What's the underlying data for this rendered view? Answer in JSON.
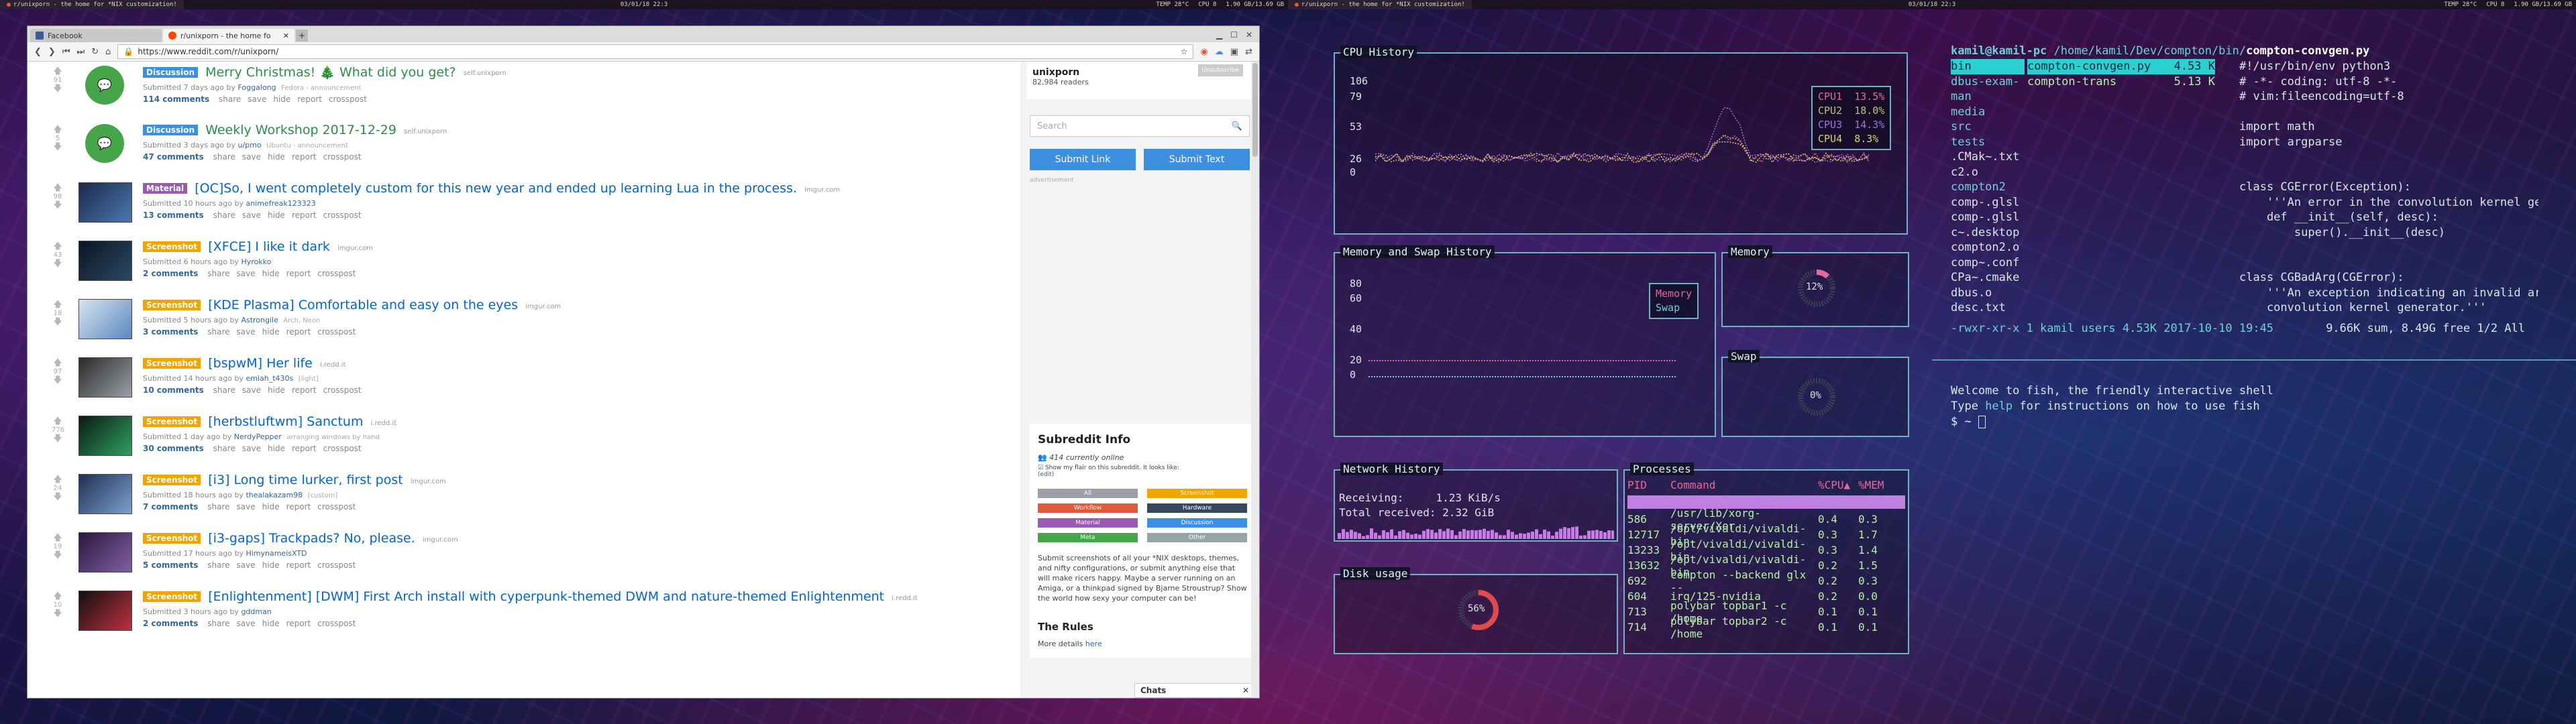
{
  "left_topbar": {
    "tabs": [
      "r/unixporn - the home for *NIX customization!"
    ],
    "clock": "03/01/18 22:3",
    "right": [
      "TEMP 28°C",
      "CPU 8",
      "1.90 GB/13.69 GB"
    ]
  },
  "right_topbar": {
    "tabs": [
      "r/unixporn - the home for *NIX customization!"
    ],
    "clock": "03/01/18 22:3",
    "right": [
      "TEMP 28°C",
      "CPU 8",
      "1.90 GB/13.69 GB"
    ]
  },
  "browser": {
    "tabs": [
      {
        "label": "Facebook",
        "color": "#3b5998"
      },
      {
        "label": "r/unixporn - the home fo",
        "color": "#ff4500"
      }
    ],
    "url": "https://www.reddit.com/r/unixporn/"
  },
  "posts": [
    {
      "score": "91",
      "flair": "Discussion",
      "flair_color": "#3d8fe0",
      "title": "Merry Christmas! 🎄 What did you get?",
      "domain": "self.unixporn",
      "meta_prefix": "Submitted 7 days ago by",
      "user": "Foggalong",
      "user_flair": "Fedora - announcement",
      "comments": "114 comments",
      "self": true
    },
    {
      "score": "5",
      "flair": "Discussion",
      "flair_color": "#3d8fe0",
      "title": "Weekly Workshop 2017-12-29",
      "domain": "self.unixporn",
      "meta_prefix": "Submitted 3 days ago by",
      "user": "u/pmo",
      "user_flair": "Ubuntu - announcement",
      "comments": "47 comments",
      "self": true
    },
    {
      "score": "98",
      "flair": "Material",
      "flair_color": "#9b59b6",
      "title": "[OC]So, I went completely custom for this new year and ended up learning Lua in the process.",
      "domain": "imgur.com",
      "meta_prefix": "Submitted 10 hours ago by",
      "user": "animefreak123323",
      "user_flair": "",
      "comments": "13 comments",
      "self": false,
      "thumb": [
        "#1b2a4a",
        "#4a78b0"
      ]
    },
    {
      "score": "43",
      "flair": "Screenshot",
      "flair_color": "#f0a500",
      "title": "[XFCE] I like it dark",
      "domain": "imgur.com",
      "meta_prefix": "Submitted 6 hours ago by",
      "user": "Hyrokko",
      "user_flair": "",
      "comments": "2 comments",
      "self": false,
      "thumb": [
        "#0a1420",
        "#2b4a66"
      ]
    },
    {
      "score": "18",
      "flair": "Screenshot",
      "flair_color": "#f0a500",
      "title": "[KDE Plasma] Comfortable and easy on the eyes",
      "domain": "imgur.com",
      "meta_prefix": "Submitted 5 hours ago by",
      "user": "Astrongile",
      "user_flair": "Arch, Neon",
      "comments": "3 comments",
      "self": false,
      "thumb": [
        "#d9e4ef",
        "#5b88c0"
      ]
    },
    {
      "score": "97",
      "flair": "Screenshot",
      "flair_color": "#f0a500",
      "title": "[bspwM] Her life",
      "domain": "i.redd.it",
      "meta_prefix": "Submitted 14 hours ago by",
      "user": "emiah_t430s",
      "user_flair": "[light]",
      "comments": "10 comments",
      "self": false,
      "thumb": [
        "#2a2a2a",
        "#9aa0a6"
      ]
    },
    {
      "score": "776",
      "flair": "Screenshot",
      "flair_color": "#f0a500",
      "title": "[herbstluftwm] Sanctum",
      "domain": "i.redd.it",
      "meta_prefix": "Submitted 1 day ago by",
      "user": "NerdyPepper",
      "user_flair": "arranging windows by hand",
      "comments": "30 comments",
      "self": false,
      "thumb": [
        "#0b1a12",
        "#2fa060"
      ]
    },
    {
      "score": "24",
      "flair": "Screenshot",
      "flair_color": "#f0a500",
      "title": "[i3] Long time lurker, first post",
      "domain": "imgur.com",
      "meta_prefix": "Submitted 18 hours ago by",
      "user": "thealakazam98",
      "user_flair": "[custom]",
      "comments": "7 comments",
      "self": false,
      "thumb": [
        "#203050",
        "#7aa0d0"
      ]
    },
    {
      "score": "19",
      "flair": "Screenshot",
      "flair_color": "#f0a500",
      "title": "[i3-gaps] Trackpads? No, please.",
      "domain": "imgur.com",
      "meta_prefix": "Submitted 17 hours ago by",
      "user": "HimynameisXTD",
      "user_flair": "",
      "comments": "5 comments",
      "self": false,
      "thumb": [
        "#2a1840",
        "#8060a0"
      ]
    },
    {
      "score": "10",
      "flair": "Screenshot",
      "flair_color": "#f0a500",
      "title": "[Enlightenment] [DWM] First Arch install with cyperpunk-themed DWM and nature-themed Enlightenment",
      "domain": "i.redd.it",
      "meta_prefix": "Submitted 3 hours ago by",
      "user": "gddman",
      "user_flair": "",
      "comments": "2 comments",
      "self": false,
      "thumb": [
        "#101010",
        "#c03040"
      ]
    }
  ],
  "post_actions": [
    "share",
    "save",
    "hide",
    "report",
    "crosspost"
  ],
  "sidebar": {
    "sub_name": "unixporn",
    "readers": "82,984 readers",
    "unsubscribe": "Unsubscribe",
    "search_placeholder": "Search",
    "submit_link": "Submit Link",
    "submit_text": "Submit Text",
    "advertisement": "advertisement",
    "info_title": "Subreddit Info",
    "online": "414 currently online",
    "show_flair": "Show my flair on this subreddit. It looks like:",
    "edit": "(edit)",
    "flairs": [
      {
        "label": "All",
        "color": "#9aa0a6"
      },
      {
        "label": "Screenshot",
        "color": "#f0a500"
      },
      {
        "label": "Workflow",
        "color": "#e05a3b"
      },
      {
        "label": "Hardware",
        "color": "#34495e"
      },
      {
        "label": "Material",
        "color": "#9b59b6"
      },
      {
        "label": "Discussion",
        "color": "#3d8fe0"
      },
      {
        "label": "Meta",
        "color": "#46a549"
      },
      {
        "label": "Other",
        "color": "#95a5a6"
      }
    ],
    "description": "Submit screenshots of all your *NIX desktops, themes, and nifty configurations, or submit anything else that will make ricers happy. Maybe a server running on an Amiga, or a thinkpad signed by Bjarne Stroustrup? Show the world how sexy your computer can be!",
    "rules_title": "The Rules",
    "more_details": "More details",
    "here": "here",
    "chats": "Chats"
  },
  "cpu": {
    "label": "CPU History",
    "yticks": [
      "106",
      "79",
      "53",
      "26",
      "0"
    ],
    "legend": [
      {
        "name": "CPU1",
        "value": "13.5%",
        "color": "#e06c9a"
      },
      {
        "name": "CPU2",
        "value": "18.0%",
        "color": "#c0c070"
      },
      {
        "name": "CPU3",
        "value": "14.3%",
        "color": "#a070e0"
      },
      {
        "name": "CPU4",
        "value": "8.3%",
        "color": "#e0d070"
      }
    ]
  },
  "memswap": {
    "label": "Memory and Swap History",
    "yticks": [
      "80",
      "60",
      "40",
      "20",
      "0"
    ],
    "legend": [
      {
        "name": "Memory",
        "color": "#e06c9a"
      },
      {
        "name": "Swap",
        "color": "#6fd0d8"
      }
    ]
  },
  "memory": {
    "label": "Memory",
    "percent": "12%",
    "value": 12
  },
  "swap": {
    "label": "Swap",
    "percent": "0%",
    "value": 0
  },
  "network": {
    "label": "Network History",
    "receiving_label": "Receiving:",
    "receiving": "1.23 KiB/s",
    "total_label": "Total received:",
    "total": "2.32 GiB"
  },
  "disk": {
    "label": "Disk usage",
    "percent": "56%",
    "value": 56
  },
  "processes": {
    "label": "Processes",
    "headers": [
      "PID",
      "Command",
      "%CPU▲",
      "%MEM"
    ],
    "rows": [
      [
        "586",
        "/usr/lib/xorg-server/Xor",
        "0.4",
        "0.3"
      ],
      [
        "12717",
        "/opt/vivaldi/vivaldi-bin",
        "0.3",
        "1.7"
      ],
      [
        "13233",
        "/opt/vivaldi/vivaldi-bin",
        "0.3",
        "1.4"
      ],
      [
        "13632",
        "/opt/vivaldi/vivaldi-bin",
        "0.2",
        "1.5"
      ],
      [
        "692",
        "compton --backend glx --",
        "0.2",
        "0.3"
      ],
      [
        "604",
        "irq/125-nvidia",
        "0.2",
        "0.0"
      ],
      [
        "713",
        "polybar topbar1 -c /home",
        "0.1",
        "0.1"
      ],
      [
        "714",
        "polybar topbar2 -c /home",
        "0.1",
        "0.1"
      ]
    ]
  },
  "ranger": {
    "header_user": "kamil@kamil-pc",
    "header_path": "/home/kamil/Dev/compton/bin/",
    "header_file": "compton-convgen.py",
    "col1": [
      "bin",
      "dbus-exam-",
      "man",
      "media",
      "src",
      "tests",
      ".CMak~.txt",
      "c2.o",
      "compton2",
      "comp-.glsl",
      "comp-.glsl",
      "c~.desktop",
      "compton2.o",
      "comp~.conf",
      "CPa~.cmake",
      "dbus.o",
      "desc.txt"
    ],
    "col2": [
      {
        "name": "compton-convgen.py",
        "size": "4.53 K"
      },
      {
        "name": "compton-trans",
        "size": "5.13 K"
      }
    ],
    "preview": [
      "#!/usr/bin/env python3",
      "# -*- coding: utf-8 -*-",
      "# vim:fileencoding=utf-8",
      "",
      "import math",
      "import argparse",
      "",
      "",
      "class CGError(Exception):",
      "    '''An error in the convolution kernel genera",
      "    def __init__(self, desc):",
      "        super().__init__(desc)",
      "",
      "",
      "class CGBadArg(CGError):",
      "    '''An exception indicating an invalid argume",
      "    convolution kernel generator.'''"
    ],
    "status_left": "-rwxr-xr-x 1 kamil users 4.53K 2017-10-10 19:45",
    "status_right": "9.66K sum, 8.49G free  1/2  All"
  },
  "fish": {
    "welcome": "Welcome to fish, the friendly interactive shell",
    "help": "Type help for instructions on how to use fish",
    "prompt": "$ ~ "
  }
}
